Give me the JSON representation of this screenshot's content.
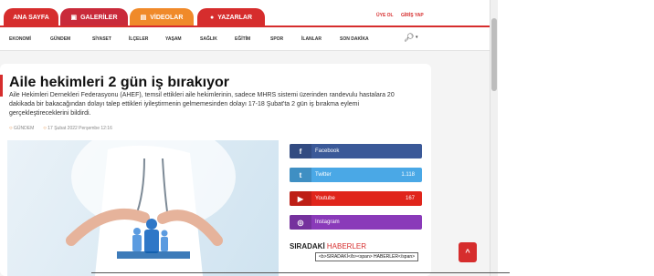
{
  "top_tabs": [
    {
      "label": "ANA SAYFA",
      "icon": "none",
      "color": "#d62d2d"
    },
    {
      "label": "GALERİLER",
      "icon": "image-icon",
      "color": "#c92a3a"
    },
    {
      "label": "VİDEOLAR",
      "icon": "video-icon",
      "color": "#f08a2a"
    },
    {
      "label": "YAZARLAR",
      "icon": "users-icon",
      "color": "#d62d2d"
    }
  ],
  "auth": {
    "register": "ÜYE OL",
    "login": "GİRİŞ YAP"
  },
  "nav": [
    "EKONOMİ",
    "GÜNDEM",
    "SİYASET",
    "İLÇELER",
    "YAŞAM",
    "SAĞLIK",
    "EĞİTİM",
    "SPOR",
    "İLANLAR",
    "SON DAKİKA"
  ],
  "article": {
    "title": "Aile hekimleri 2 gün iş bırakıyor",
    "lead": "Aile Hekimleri Dernekleri Federasyonu (AHEF), temsil ettikleri aile hekimlerinin, sadece MHRS sistemi üzerinden randevulu hastalara 20 dakikada bir bakacağından dolayı talep ettikleri iyileştirmenin gelmemesinden dolayı 17-18 Şubat'ta 2 gün iş bırakma eylemi gerçekleştireceklerini bildirdi.",
    "category": "GÜNDEM",
    "date": "17 Şubat 2022 Perşembe 12:16"
  },
  "social": [
    {
      "name": "Facebook",
      "icon": "f",
      "count": "",
      "color": "#3b5998"
    },
    {
      "name": "Twitter",
      "icon": "t",
      "count": "1.118",
      "color": "#4aa8e6"
    },
    {
      "name": "Youtube",
      "icon": "▶",
      "count": "167",
      "color": "#e0251b"
    },
    {
      "name": "Instagram",
      "icon": "◎",
      "count": "",
      "color": "#8a3ab9"
    }
  ],
  "siradaki": {
    "bold": "SIRADAKİ",
    "rest": " HABERLER"
  },
  "tooltip": "<b>SIRADAKİ</b><span> HABERLER</span>",
  "up_glyph": "^"
}
